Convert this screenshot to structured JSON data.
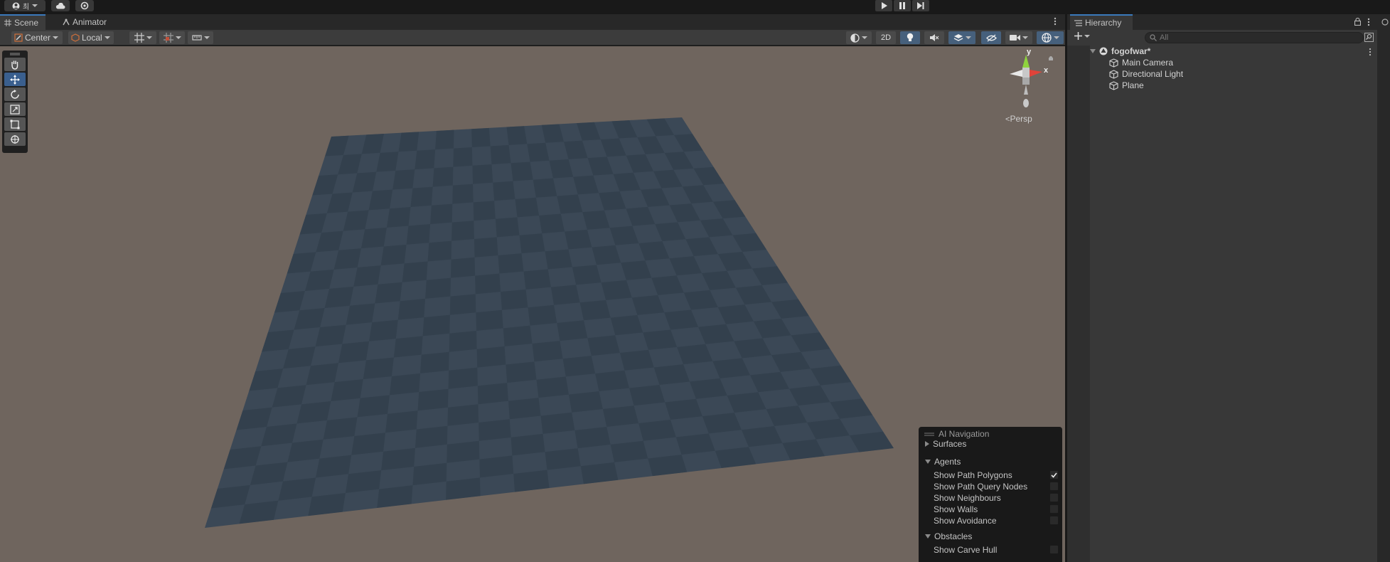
{
  "topbar": {
    "account_label": "최",
    "icons": [
      "account-icon",
      "cloud-icon",
      "settings-icon",
      "play-icon",
      "pause-icon",
      "step-icon"
    ]
  },
  "scene_panel": {
    "tabs": [
      {
        "label": "Scene",
        "icon": "grid-icon",
        "active": true
      },
      {
        "label": "Animator",
        "icon": "animator-icon",
        "active": false
      }
    ],
    "toolbar": {
      "pivot_mode": "Center",
      "pivot_rotation": "Local",
      "view_2d_label": "2D"
    },
    "tools": [
      "hand-tool",
      "move-tool",
      "rotate-tool",
      "scale-tool",
      "rect-tool",
      "transform-tool"
    ],
    "selected_tool": "move-tool",
    "gizmo": {
      "y_label": "y",
      "x_label": "x",
      "projection_label": "Persp"
    },
    "ai_navigation": {
      "title": "AI Navigation",
      "sections": [
        {
          "label": "Surfaces",
          "expanded": false,
          "items": []
        },
        {
          "label": "Agents",
          "expanded": true,
          "items": [
            {
              "label": "Show Path Polygons",
              "checked": true
            },
            {
              "label": "Show Path Query Nodes",
              "checked": false
            },
            {
              "label": "Show Neighbours",
              "checked": false
            },
            {
              "label": "Show Walls",
              "checked": false
            },
            {
              "label": "Show Avoidance",
              "checked": false
            }
          ]
        },
        {
          "label": "Obstacles",
          "expanded": true,
          "items": [
            {
              "label": "Show Carve Hull",
              "checked": false
            }
          ]
        }
      ]
    }
  },
  "hierarchy": {
    "tab_label": "Hierarchy",
    "search_placeholder": "All",
    "scene_name": "fogofwar*",
    "objects": [
      "Main Camera",
      "Directional Light",
      "Plane"
    ]
  },
  "colors": {
    "viewport_bg": "#6f655e",
    "plane_dark": "#33404d",
    "plane_light": "#3b4856",
    "accent": "#3a79bb",
    "axis_x": "#e0433a",
    "axis_y": "#8fd33d"
  }
}
